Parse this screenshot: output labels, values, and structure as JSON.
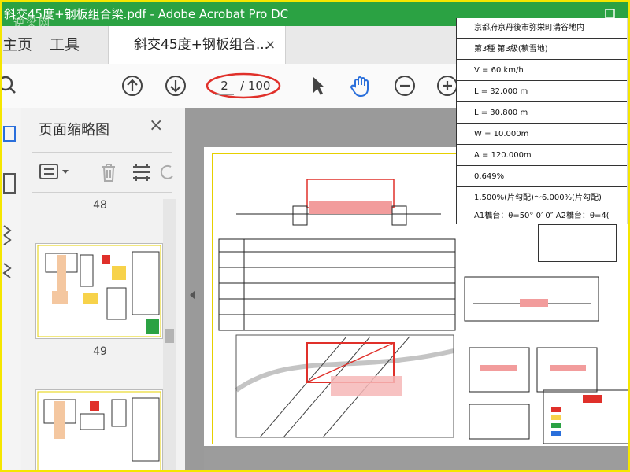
{
  "window": {
    "title": "斜交45度+钢板组合梁.pdf - Adobe Acrobat Pro DC",
    "watermark": "逆梁网"
  },
  "tabs": {
    "home": "主页",
    "tools": "工具",
    "document": "斜交45度+钢板组合...",
    "close": "×"
  },
  "toolbar": {
    "current_page": "2",
    "total_pages": "/ 100"
  },
  "panel": {
    "title": "页面缩略图",
    "close": "×",
    "pages": [
      {
        "label": "48"
      },
      {
        "label": "49"
      }
    ]
  },
  "overlay": {
    "rows": [
      "京都府京丹後市弥栄町溝谷地内",
      "第3種 第3級(積雪地)",
      "V = 60 km/h",
      "L = 32.000 m",
      "L = 30.800 m",
      "W = 10.000m",
      "A = 120.000m",
      "0.649%",
      "1.500%(片勾配)〜6.000%(片勾配)",
      "A1橋台：θ=50° 0′ 0″   A2橋台：θ=4("
    ]
  },
  "colors": {
    "titlebar": "#2ba243",
    "border": "#f5e600",
    "accent_red": "#e0302a",
    "icon_blue": "#2a6fdb"
  }
}
